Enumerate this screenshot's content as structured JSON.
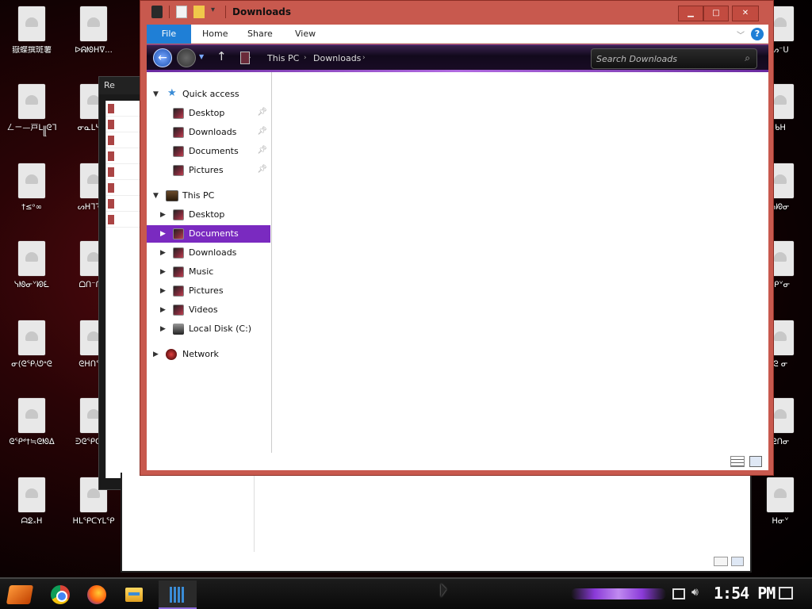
{
  "desktop": {
    "left_icons": [
      {
        "label": "嶽蝶撰斑薯"
      },
      {
        "label": "ㄥㄧ—戸ᒪ꧋ᘓᒣ"
      },
      {
        "label": "†≤ᵒ∞"
      },
      {
        "label": "ᓭᘚᓂᘁᘗᘍ"
      },
      {
        "label": "ᓂ(ᘓᕿ₍ᘎᐤᘓ"
      },
      {
        "label": "ᘓᕿᒄ†≒ᘓᘚᐃ"
      },
      {
        "label": "ᗩᘖ᙮ᕼ"
      }
    ],
    "second_icons": [
      {
        "label": "ᐅᕱᘚᕼᐁ..."
      },
      {
        "label": "ᓂᓇᒪᓴᓭᒣ"
      },
      {
        "label": "ᔕᕼᒣᘋᕿ"
      },
      {
        "label": "ᗝᑎ⁻ᑎᓂ"
      },
      {
        "label": "ᘓᕼᑎᕿᘁ"
      },
      {
        "label": "ᕭᘓᕿᑕᘁᘗ"
      },
      {
        "label": "ᕼᒪᕿᑕYᒪᕿ"
      }
    ],
    "right_icons": [
      {
        "label": "ᔕ⁻ᑌ"
      },
      {
        "label": "ᑲᕼ"
      },
      {
        "label": "ᓭᘗᓂ"
      },
      {
        "label": "ᕿᘁᓂ"
      },
      {
        "label": "ᘓ ᓂ"
      },
      {
        "label": "ᘓᑎᓂ"
      },
      {
        "label": "ᕼᓂᘁ"
      }
    ]
  },
  "background_window": {
    "title": "Re"
  },
  "explorer": {
    "title": "Downloads",
    "ribbon_tabs": {
      "file": "File",
      "home": "Home",
      "share": "Share",
      "view": "View"
    },
    "help_glyph": "?",
    "address": {
      "crumbs": [
        "This PC",
        "Downloads"
      ]
    },
    "search": {
      "placeholder": "Search Downloads"
    },
    "nav": {
      "quick_access": {
        "label": "Quick access"
      },
      "quick_items": [
        {
          "label": "Desktop"
        },
        {
          "label": "Downloads"
        },
        {
          "label": "Documents"
        },
        {
          "label": "Pictures"
        }
      ],
      "this_pc": {
        "label": "This PC"
      },
      "pc_items": [
        {
          "label": "Desktop"
        },
        {
          "label": "Documents"
        },
        {
          "label": "Downloads"
        },
        {
          "label": "Music"
        },
        {
          "label": "Pictures"
        },
        {
          "label": "Videos"
        },
        {
          "label": "Local Disk (C:)"
        }
      ],
      "network": {
        "label": "Network"
      }
    },
    "selected_item": "Documents"
  },
  "taskbar": {
    "clock": "1:54 PM"
  },
  "colors": {
    "accent_window": "#c8594e",
    "selection": "#7a2ac0",
    "ribbon_file": "#1f7fd6"
  }
}
